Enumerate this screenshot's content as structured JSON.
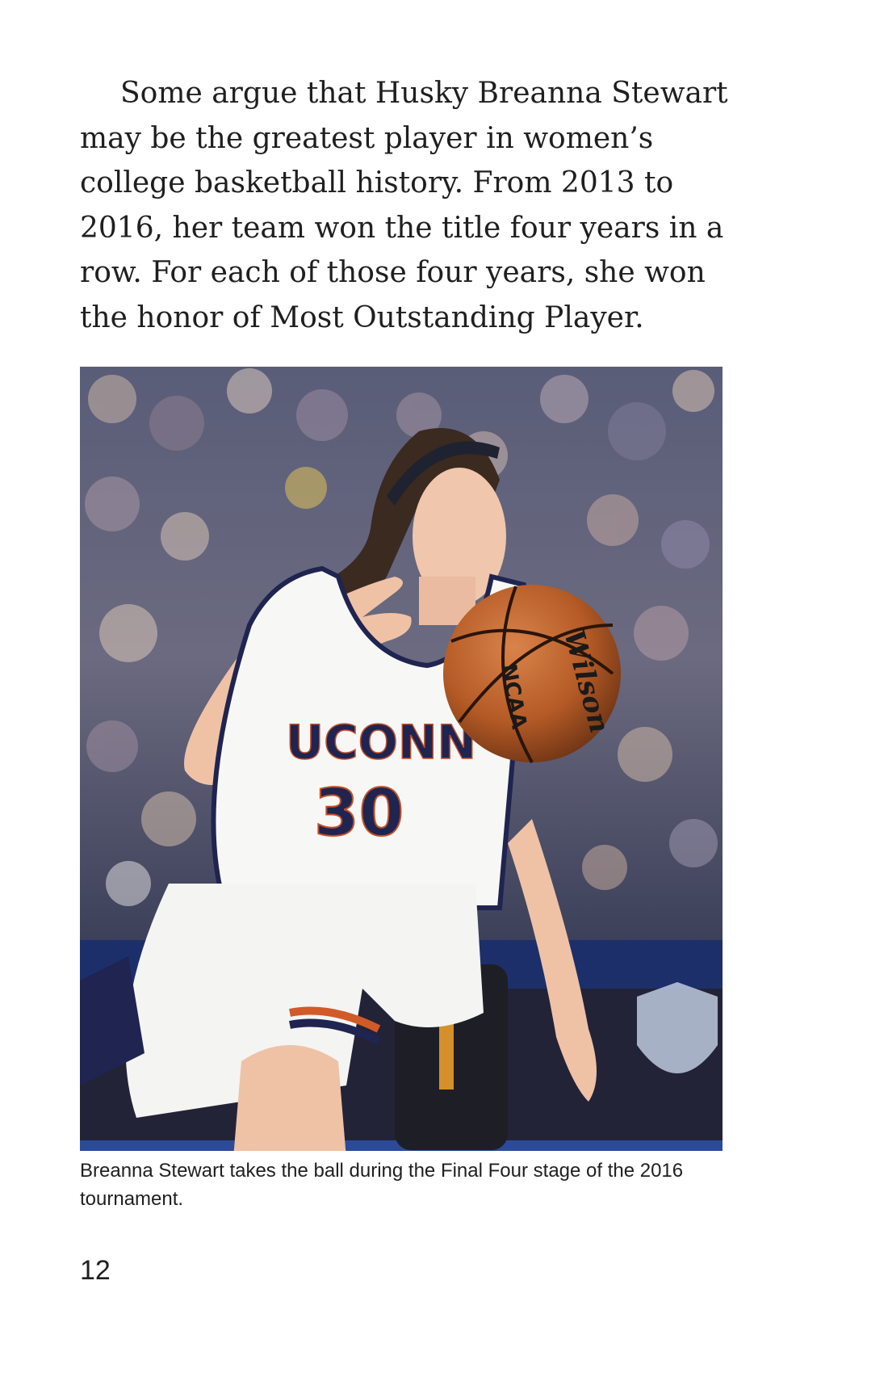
{
  "body_text": "Some argue that Husky Breanna Stewart may be the greatest player in women’s college basketball history. From 2013 to 2016, her team won the title four years in a row. For each of those four years, she won the honor of Most Outstanding Player.",
  "photo": {
    "jersey_team": "UCONN",
    "jersey_number": "30",
    "ball_brand": "Wilson",
    "ball_logo": "NCAA"
  },
  "caption": "Breanna Stewart takes the ball during the Final Four stage of the 2016 tournament.",
  "page_number": "12"
}
